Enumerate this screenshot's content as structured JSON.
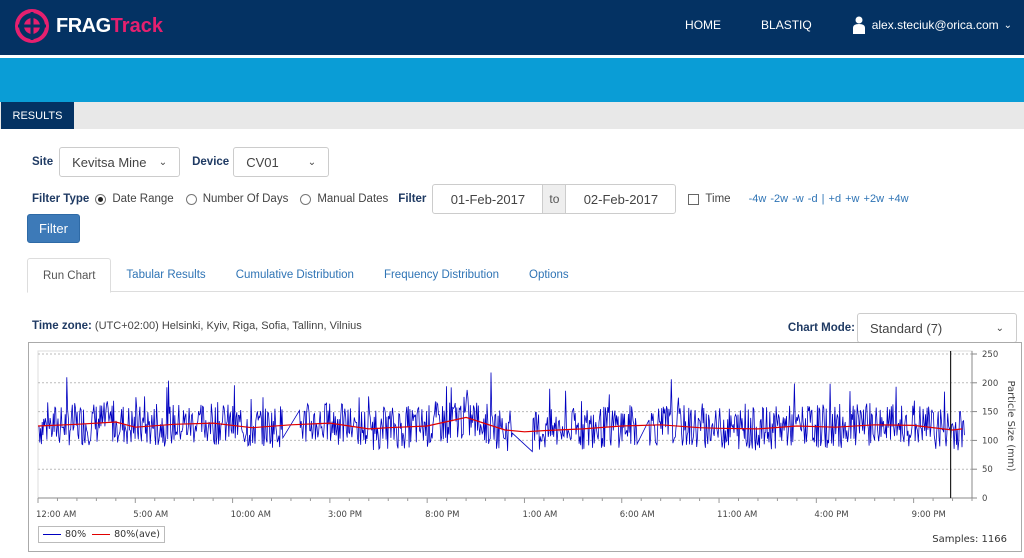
{
  "header": {
    "logo_part1": "FRAG",
    "logo_part2": "Track",
    "nav": [
      "HOME",
      "BLASTIQ"
    ],
    "user": "alex.steciuk@orica.com"
  },
  "section_tab": "RESULTS",
  "filters": {
    "site_label": "Site",
    "site_value": "Kevitsa Mine",
    "device_label": "Device",
    "device_value": "CV01",
    "filter_type_label": "Filter Type",
    "filter_types": [
      {
        "label": "Date Range",
        "selected": true
      },
      {
        "label": "Number Of Days",
        "selected": false
      },
      {
        "label": "Manual Dates",
        "selected": false
      }
    ],
    "filter_label": "Filter",
    "date_from": "01-Feb-2017",
    "to_label": "to",
    "date_to": "02-Feb-2017",
    "time_label": "Time",
    "time_checked": false,
    "quick_links": "-4w -2w -w -d | +d +w +2w +4w",
    "filter_button": "Filter"
  },
  "tabs": [
    {
      "label": "Run Chart",
      "active": true
    },
    {
      "label": "Tabular Results",
      "active": false
    },
    {
      "label": "Cumulative Distribution",
      "active": false
    },
    {
      "label": "Frequency Distribution",
      "active": false
    },
    {
      "label": "Options",
      "active": false
    }
  ],
  "timezone_label": "Time zone:",
  "timezone_value": "(UTC+02:00) Helsinki, Kyiv, Riga, Sofia, Tallinn, Vilnius",
  "chart_mode_label": "Chart Mode:",
  "chart_mode_value": "Standard (7)",
  "samples_text": "Samples: 1166",
  "chart_data": {
    "type": "line",
    "title": "",
    "xlabel": "",
    "ylabel": "Particle Size (mm)",
    "ylim": [
      0,
      250
    ],
    "yticks": [
      0,
      50,
      100,
      150,
      200,
      250
    ],
    "xlim_hours": [
      0,
      48
    ],
    "xticks": [
      {
        "hour": 0,
        "label": "12:00 AM"
      },
      {
        "hour": 5,
        "label": "5:00 AM"
      },
      {
        "hour": 10,
        "label": "10:00 AM"
      },
      {
        "hour": 15,
        "label": "3:00 PM"
      },
      {
        "hour": 20,
        "label": "8:00 PM"
      },
      {
        "hour": 25,
        "label": "1:00 AM"
      },
      {
        "hour": 30,
        "label": "6:00 AM"
      },
      {
        "hour": 35,
        "label": "11:00 AM"
      },
      {
        "hour": 40,
        "label": "4:00 PM"
      },
      {
        "hour": 45,
        "label": "9:00 PM"
      }
    ],
    "grid": true,
    "legend_position": "bottom-left",
    "marker_hour": 46.9,
    "series": [
      {
        "name": "80%",
        "color": "#0000c0",
        "approx_mean": 120,
        "approx_range": [
          70,
          230
        ],
        "samples": 1166,
        "gaps_hours": [
          [
            12.6,
            13.4
          ],
          [
            24.4,
            25.4
          ],
          [
            30.8,
            31.4
          ]
        ]
      },
      {
        "name": "80%(ave)",
        "color": "#e00000",
        "x_hours": [
          0,
          2,
          4,
          5,
          7,
          9,
          11,
          13,
          15,
          17,
          18,
          20,
          22,
          24,
          25,
          26,
          28,
          30,
          32,
          34,
          35,
          37,
          39,
          41,
          43,
          45,
          47,
          47.5
        ],
        "values": [
          125,
          128,
          132,
          123,
          128,
          130,
          122,
          127,
          130,
          120,
          122,
          125,
          140,
          118,
          115,
          117,
          120,
          125,
          127,
          122,
          121,
          120,
          125,
          123,
          127,
          126,
          118,
          120
        ]
      }
    ]
  }
}
